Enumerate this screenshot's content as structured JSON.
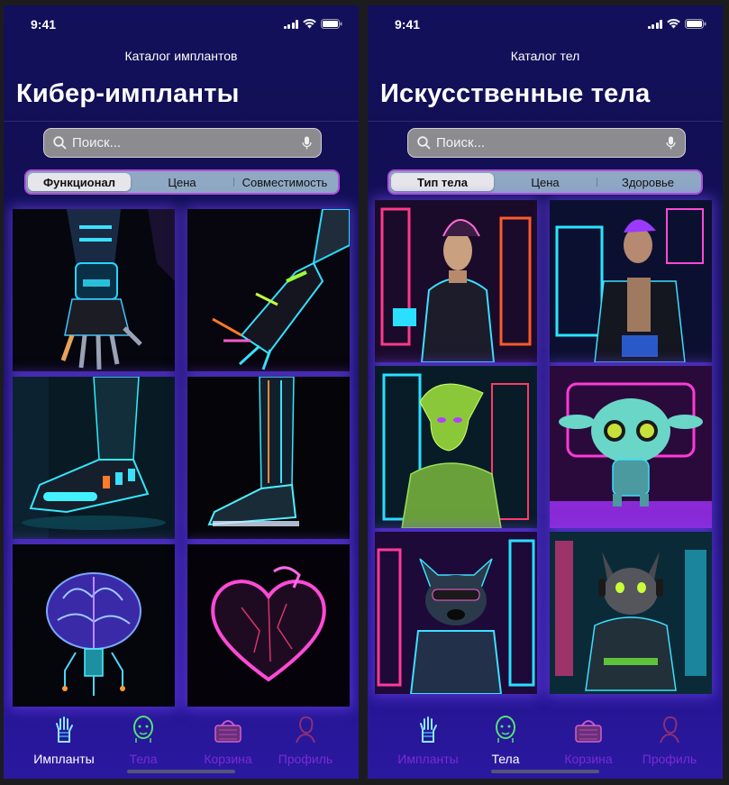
{
  "colors": {
    "background": "#12105a",
    "accent_purple": "#b04fd8",
    "segment_bg": "#8fa9c4",
    "tab_inactive": "#7a2ad6"
  },
  "left": {
    "status_time": "9:41",
    "nav_title": "Каталог имплантов",
    "large_title": "Кибер-импланты",
    "search_placeholder": "Поиск...",
    "segments": [
      "Функционал",
      "Цена",
      "Совместимость"
    ],
    "selected_segment": "Функционал",
    "tiles": [
      "cyber-hand",
      "cyber-hand-glowing",
      "cyber-foot",
      "cyber-leg",
      "neon-brain",
      "neon-heart"
    ],
    "tabs": [
      "Импланты",
      "Тела",
      "Корзина",
      "Профиль"
    ],
    "active_tab": "Импланты"
  },
  "right": {
    "status_time": "9:41",
    "nav_title": "Каталог тел",
    "large_title": "Искусственные тела",
    "search_placeholder": "Поиск...",
    "segments": [
      "Тип тела",
      "Цена",
      "Здоровье"
    ],
    "selected_segment": "Тип тела",
    "tiles": [
      "cyber-woman",
      "cyber-man",
      "alien-humanoid",
      "cute-alien",
      "cyber-dog",
      "cyber-cat"
    ],
    "tabs": [
      "Импланты",
      "Тела",
      "Корзина",
      "Профиль"
    ],
    "active_tab": "Тела"
  }
}
